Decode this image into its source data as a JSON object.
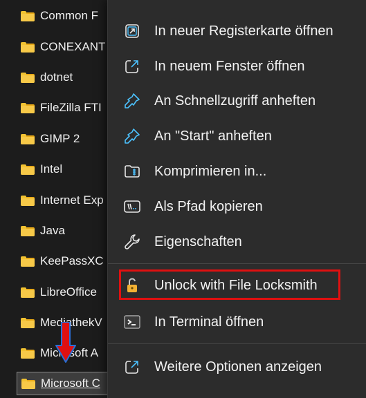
{
  "folder_list": {
    "items": [
      {
        "label": "Common F"
      },
      {
        "label": "CONEXANT"
      },
      {
        "label": "dotnet"
      },
      {
        "label": "FileZilla FTI"
      },
      {
        "label": "GIMP 2"
      },
      {
        "label": "Intel"
      },
      {
        "label": "Internet Exp"
      },
      {
        "label": "Java"
      },
      {
        "label": "KeePassXC"
      },
      {
        "label": "LibreOffice"
      },
      {
        "label": "MediathekV"
      },
      {
        "label": "Microsoft A"
      },
      {
        "label": "Microsoft C"
      }
    ]
  },
  "context_menu": {
    "items": [
      {
        "label": "In neuer Registerkarte öffnen",
        "icon": "new-tab-icon"
      },
      {
        "label": "In neuem Fenster öffnen",
        "icon": "new-window-icon"
      },
      {
        "label": "An Schnellzugriff anheften",
        "icon": "pin-icon"
      },
      {
        "label": "An \"Start\" anheften",
        "icon": "pin-start-icon"
      },
      {
        "label": "Komprimieren in...",
        "icon": "zip-folder-icon"
      },
      {
        "label": "Als Pfad kopieren",
        "icon": "copy-path-icon"
      },
      {
        "label": "Eigenschaften",
        "icon": "wrench-icon"
      },
      {
        "label": "Unlock with File Locksmith",
        "icon": "padlock-icon"
      },
      {
        "label": "In Terminal öffnen",
        "icon": "terminal-icon"
      },
      {
        "label": "Weitere Optionen anzeigen",
        "icon": "more-options-icon"
      }
    ]
  },
  "colors": {
    "accent": "#4cc2ff",
    "highlight": "#e01010",
    "arrow": "#e01010",
    "arrow_outline": "#2a6fd6",
    "folder": "#f7c948"
  }
}
